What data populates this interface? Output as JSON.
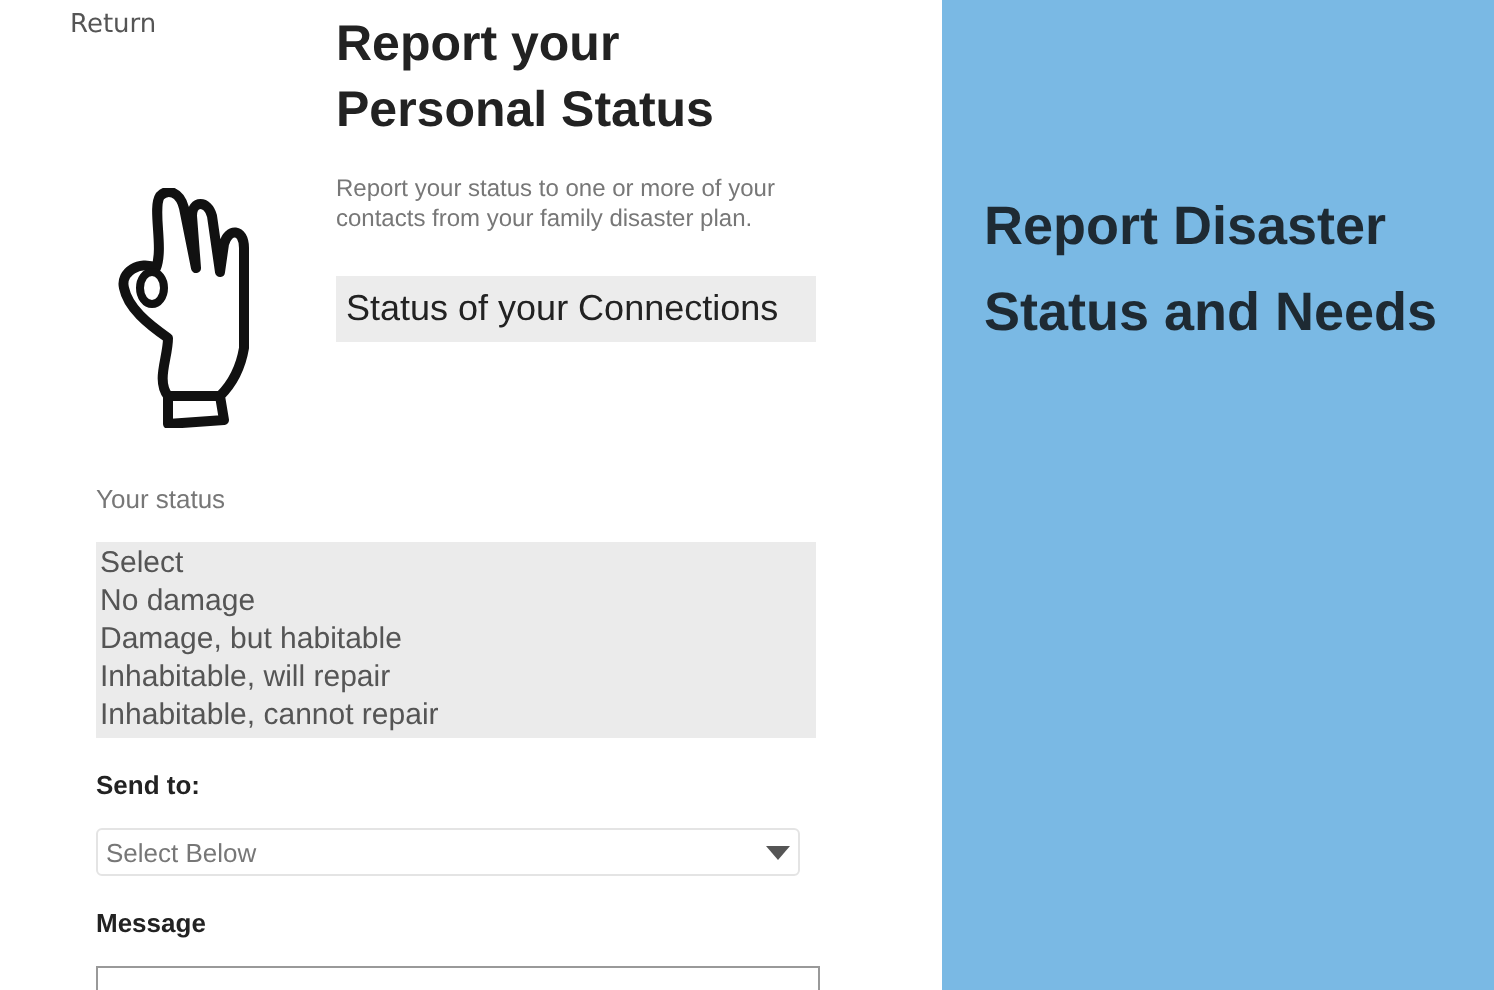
{
  "return_link": "Return",
  "title": "Report your Personal Status",
  "description": "Report your status to one or more of your contacts from your family disaster plan.",
  "connections_button": "Status of your Connections",
  "status_label": "Your status",
  "status_options": [
    {
      "label": "Select"
    },
    {
      "label": "No damage"
    },
    {
      "label": "Damage, but habitable"
    },
    {
      "label": "Inhabitable, will repair"
    },
    {
      "label": "Inhabitable, cannot repair"
    }
  ],
  "send_to_label": "Send to:",
  "send_to_select": "Select Below",
  "message_label": "Message",
  "side_heading": "Report Disaster Status and Needs"
}
